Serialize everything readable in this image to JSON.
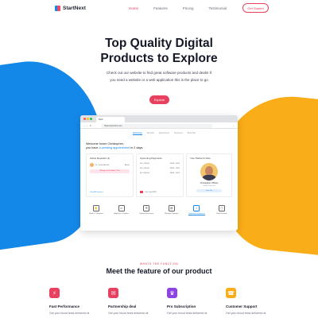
{
  "nav": {
    "brand": "StartNext",
    "links": [
      "Home",
      "Features",
      "Pricing",
      "Testimonial"
    ],
    "active_link": "Home",
    "cta": "Get Started"
  },
  "hero": {
    "title_line1": "Top Quality Digital",
    "title_line2": "Products to Explore",
    "subtitle": "Check out our website to find great software products and deals! If you need a website or a web application this is the place to go",
    "cta": "Explore"
  },
  "browser": {
    "tab_title": "PetC",
    "url": "https://petclinic.com",
    "inner_nav": [
      "Dashboard",
      "Records",
      "Appointment",
      "Payments",
      "Book Slot"
    ],
    "welcome_line1": "Welcome home Christopher,",
    "welcome_line2_prefix": "you have ",
    "welcome_highlight": "a pending appointment",
    "welcome_line2_suffix": " in 2 days.",
    "card_active": {
      "title": "Active Deposits (1)",
      "user": "Dr. Jacob Mitchell",
      "status": "Active",
      "pill": "Waiting on the Medical Test",
      "link": "View All Deposits"
    },
    "card_upcoming": {
      "title": "Upcoming Payments",
      "rows": [
        {
          "label": "Rs 1,200.00",
          "value": "20/08 · 2023"
        },
        {
          "label": "Rs 1,500.00",
          "value": "03/09 · 2023"
        },
        {
          "label": "Rs 2,000.00",
          "value": "28/09 · 2023"
        }
      ],
      "footer": "Tata Card 9821"
    },
    "card_pet": {
      "title": "Your Partner's Pets",
      "name": "Christopher O'Brien",
      "sub": "Golden Retriever",
      "button": "View Pet"
    },
    "actions": [
      {
        "label": "Book a Treatment",
        "icon": "paw-icon"
      },
      {
        "label": "Apply for a Deposit",
        "icon": "wallet-icon"
      },
      {
        "label": "Upload Document",
        "icon": "document-icon"
      },
      {
        "label": "Manage Payment",
        "icon": "card-icon"
      },
      {
        "label": "Download Statement",
        "icon": "download-icon",
        "active": true
      },
      {
        "label": "Refer Friends",
        "icon": "gift-icon"
      }
    ]
  },
  "features_section": {
    "eyebrow": "WHATS THE FUNCTION",
    "title": "Meet the feature of our product",
    "items": [
      {
        "title": "Fast Performance",
        "desc": "Get your blood tests delivered at",
        "color": "#e8405f",
        "icon": "lightning-icon"
      },
      {
        "title": "Partnership deal",
        "desc": "Get your blood tests delivered at",
        "color": "#e8405f",
        "icon": "handshake-icon"
      },
      {
        "title": "Pro Subscription",
        "desc": "Get your blood tests delivered at",
        "color": "#8c45e3",
        "icon": "star-icon"
      },
      {
        "title": "Customer Support",
        "desc": "Get your blood tests delivered at",
        "color": "#f9ad18",
        "icon": "headset-icon"
      }
    ]
  },
  "colors": {
    "accent": "#e8405f",
    "blue": "#1488e8",
    "yellow": "#f9ad18"
  }
}
